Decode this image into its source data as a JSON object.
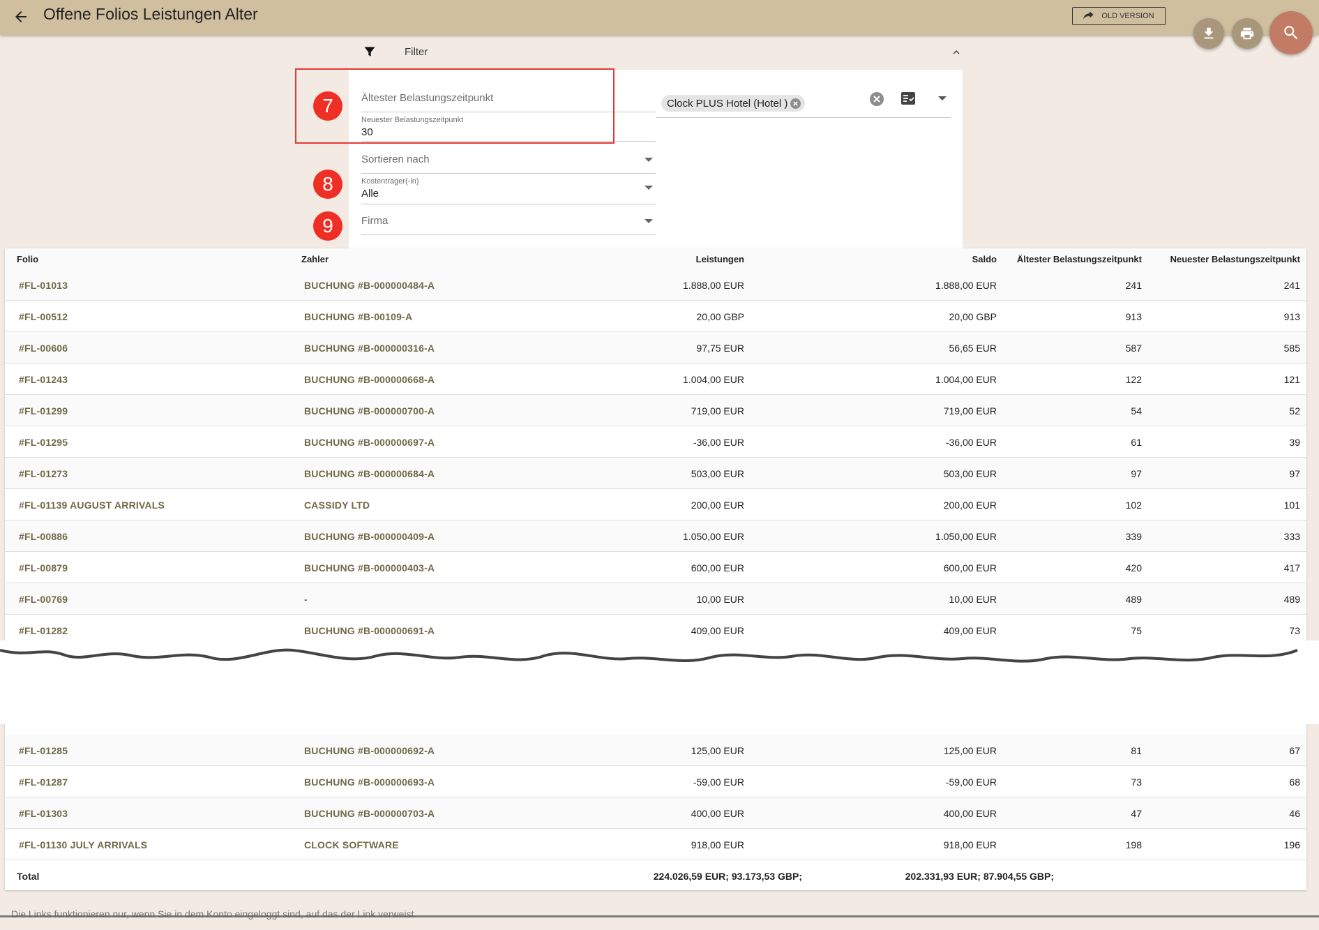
{
  "header": {
    "title": "Offene Folios Leistungen Alter",
    "old_version_label": "OLD VERSION"
  },
  "filter": {
    "label": "Filter",
    "oldest_placeholder": "Ältester Belastungszeitpunkt",
    "newest_label": "Neuester Belastungszeitpunkt",
    "newest_value": "30",
    "sort_placeholder": "Sortieren nach",
    "cost_label": "Kostenträger(-in)",
    "cost_value": "Alle",
    "company_placeholder": "Firma",
    "hotel_chip": "Clock PLUS Hotel (Hotel )"
  },
  "badges": {
    "step7": "7",
    "step8": "8",
    "step9": "9"
  },
  "table": {
    "columns": {
      "folio": "Folio",
      "payer": "Zahler",
      "services": "Leistungen",
      "balance": "Saldo",
      "oldest": "Ältester Belastungszeitpunkt",
      "newest": "Neuester Belastungszeitpunkt"
    },
    "rows": [
      {
        "folio": "#FL-01013",
        "payer": "BUCHUNG #B-000000484-A",
        "services": "1.888,00 EUR",
        "balance": "1.888,00 EUR",
        "oldest": "241",
        "newest": "241"
      },
      {
        "folio": "#FL-00512",
        "payer": "BUCHUNG #B-00109-A",
        "services": "20,00 GBP",
        "balance": "20,00 GBP",
        "oldest": "913",
        "newest": "913"
      },
      {
        "folio": "#FL-00606",
        "payer": "BUCHUNG #B-000000316-A",
        "services": "97,75 EUR",
        "balance": "56,65 EUR",
        "oldest": "587",
        "newest": "585"
      },
      {
        "folio": "#FL-01243",
        "payer": "BUCHUNG #B-000000668-A",
        "services": "1.004,00 EUR",
        "balance": "1.004,00 EUR",
        "oldest": "122",
        "newest": "121"
      },
      {
        "folio": "#FL-01299",
        "payer": "BUCHUNG #B-000000700-A",
        "services": "719,00 EUR",
        "balance": "719,00 EUR",
        "oldest": "54",
        "newest": "52"
      },
      {
        "folio": "#FL-01295",
        "payer": "BUCHUNG #B-000000697-A",
        "services": "-36,00 EUR",
        "balance": "-36,00 EUR",
        "oldest": "61",
        "newest": "39"
      },
      {
        "folio": "#FL-01273",
        "payer": "BUCHUNG #B-000000684-A",
        "services": "503,00 EUR",
        "balance": "503,00 EUR",
        "oldest": "97",
        "newest": "97"
      },
      {
        "folio": "#FL-01139 AUGUST ARRIVALS",
        "payer": "CASSIDY LTD",
        "services": "200,00 EUR",
        "balance": "200,00 EUR",
        "oldest": "102",
        "newest": "101"
      },
      {
        "folio": "#FL-00886",
        "payer": "BUCHUNG #B-000000409-A",
        "services": "1.050,00 EUR",
        "balance": "1.050,00 EUR",
        "oldest": "339",
        "newest": "333"
      },
      {
        "folio": "#FL-00879",
        "payer": "BUCHUNG #B-000000403-A",
        "services": "600,00 EUR",
        "balance": "600,00 EUR",
        "oldest": "420",
        "newest": "417"
      },
      {
        "folio": "#FL-00769",
        "payer": "-",
        "services": "10,00 EUR",
        "balance": "10,00 EUR",
        "oldest": "489",
        "newest": "489"
      },
      {
        "folio": "#FL-01282",
        "payer": "BUCHUNG #B-000000691-A",
        "services": "409,00 EUR",
        "balance": "409,00 EUR",
        "oldest": "75",
        "newest": "73"
      }
    ],
    "rows_after_break": [
      {
        "folio": "#FL-01285",
        "payer": "BUCHUNG #B-000000692-A",
        "services": "125,00 EUR",
        "balance": "125,00 EUR",
        "oldest": "81",
        "newest": "67"
      },
      {
        "folio": "#FL-01287",
        "payer": "BUCHUNG #B-000000693-A",
        "services": "-59,00 EUR",
        "balance": "-59,00 EUR",
        "oldest": "73",
        "newest": "68"
      },
      {
        "folio": "#FL-01303",
        "payer": "BUCHUNG #B-000000703-A",
        "services": "400,00 EUR",
        "balance": "400,00 EUR",
        "oldest": "47",
        "newest": "46"
      },
      {
        "folio": "#FL-01130 JULY ARRIVALS",
        "payer": "CLOCK SOFTWARE",
        "services": "918,00 EUR",
        "balance": "918,00 EUR",
        "oldest": "198",
        "newest": "196"
      }
    ],
    "total": {
      "label": "Total",
      "services": "224.026,59 EUR; 93.173,53 GBP;",
      "balance": "202.331,93 EUR; 87.904,55 GBP;"
    }
  },
  "footnote": "Die Links funktionieren nur, wenn Sie in dem Konto eingeloggt sind, auf das der Link verweist.",
  "colors": {
    "header_bg": "#cfbf9f",
    "page_bg": "#f3ebe3",
    "link_text": "#6e6a47",
    "fab_primary": "#c27c65",
    "fab_secondary": "#a8977b",
    "badge_red": "#ef2f25"
  },
  "icons": {
    "back": "arrow-left-icon",
    "old_version": "share-arrow-icon",
    "download": "download-icon",
    "print": "print-icon",
    "search": "search-icon",
    "filter": "filter-funnel-icon",
    "collapse": "chevron-up-icon",
    "clear": "clear-circle-icon",
    "select_all": "checklist-icon",
    "dropdown": "caret-down-icon"
  }
}
